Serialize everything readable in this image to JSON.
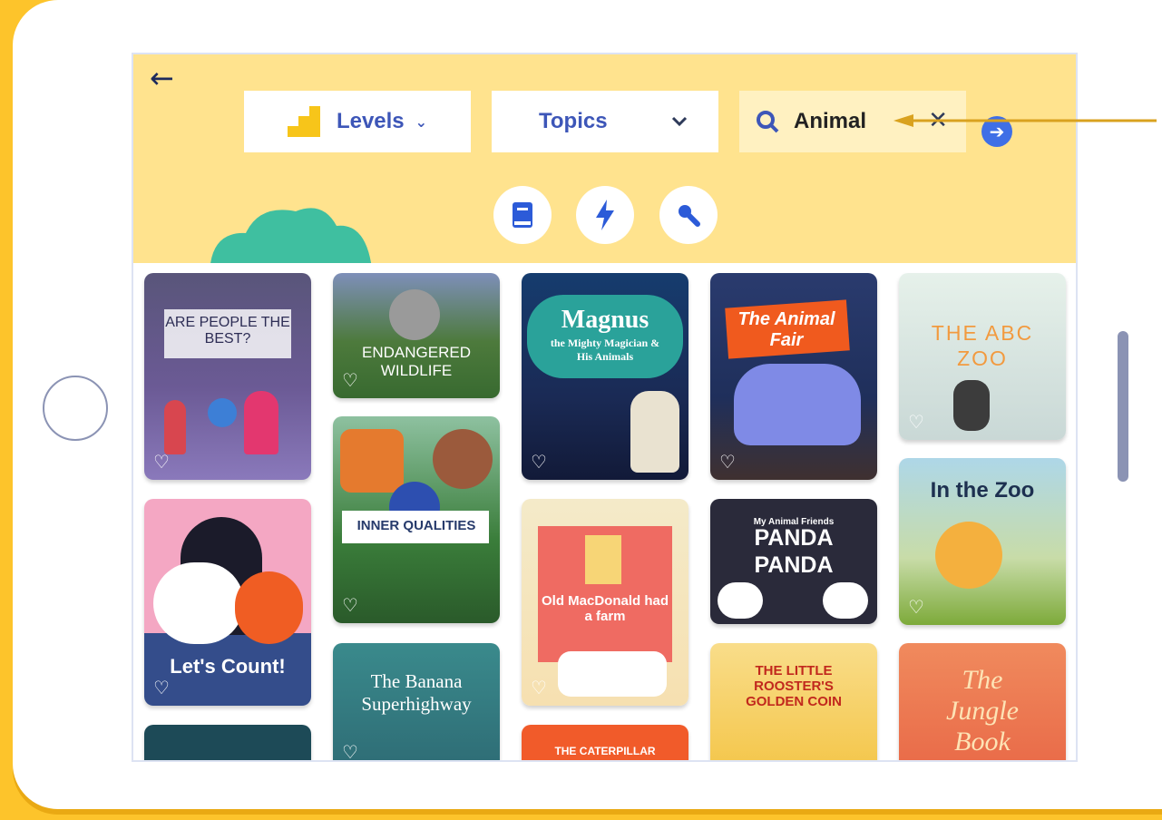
{
  "header": {
    "back_icon": "arrow-left-icon",
    "levels_label": "Levels",
    "topics_label": "Topics",
    "search": {
      "value": "Animal",
      "placeholder": "Search",
      "clear_icon": "close-icon",
      "go_icon": "arrow-right-icon"
    },
    "category_icons": [
      "book-icon",
      "lightning-icon",
      "search-icon"
    ]
  },
  "books": [
    {
      "title": "ARE PEOPLE THE BEST?"
    },
    {
      "title": "Let's Count!"
    },
    {
      "title": "ENDANGERED WILDLIFE"
    },
    {
      "title": "INNER QUALITIES"
    },
    {
      "title": "The Banana Superhighway"
    },
    {
      "title": "Magnus",
      "subtitle": "the Mighty Magician & His Animals"
    },
    {
      "title": "Old MacDonald had a farm"
    },
    {
      "title": "THE CATERPILLAR"
    },
    {
      "title": "The Animal Fair"
    },
    {
      "title": "PANDA PANDA",
      "subtitle": "My Animal Friends"
    },
    {
      "title": "THE LITTLE ROOSTER'S GOLDEN COIN"
    },
    {
      "title": "THE ABC ZOO"
    },
    {
      "title": "In the Zoo"
    },
    {
      "title": "The Jungle Book"
    }
  ],
  "colors": {
    "accent": "#3d56b8",
    "topbar": "#ffe38e",
    "frame": "#fdc42b"
  }
}
